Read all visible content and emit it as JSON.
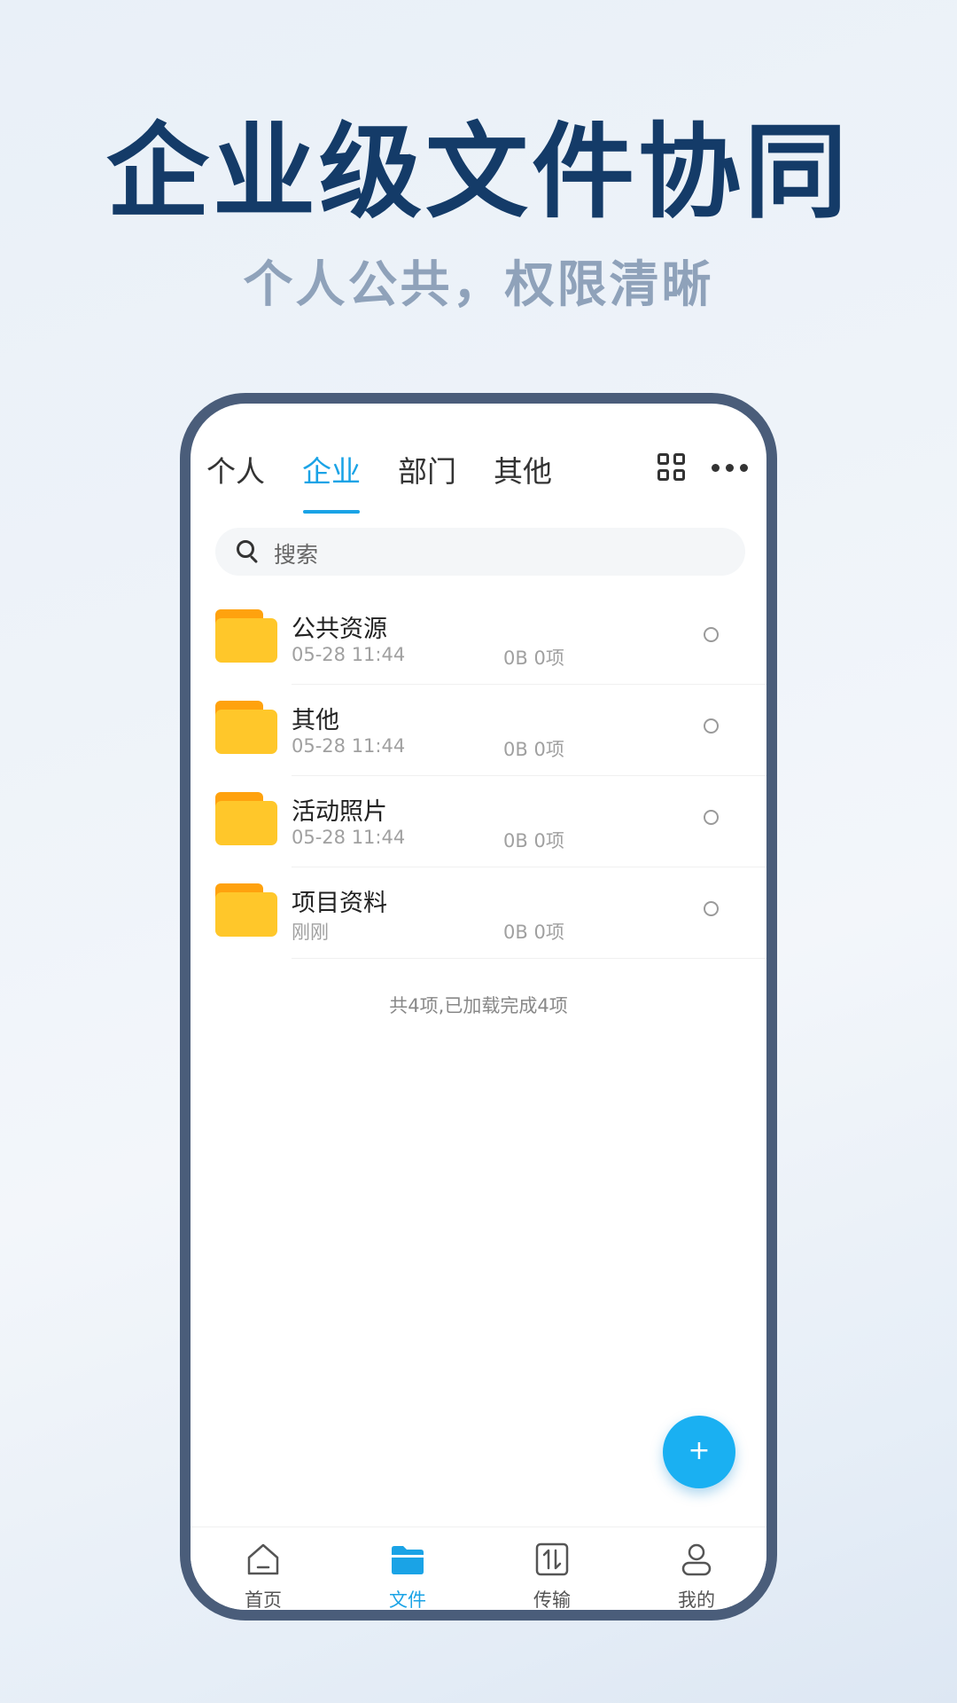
{
  "hero": {
    "title": "企业级文件协同",
    "subtitle": "个人公共，权限清晰"
  },
  "tabs": [
    {
      "label": "个人",
      "active": false
    },
    {
      "label": "企业",
      "active": true
    },
    {
      "label": "部门",
      "active": false
    },
    {
      "label": "其他",
      "active": false
    }
  ],
  "toolbar": {
    "icons": [
      "grid-view-icon",
      "more-icon"
    ]
  },
  "search": {
    "placeholder": "搜索"
  },
  "files": [
    {
      "name": "公共资源",
      "date": "05-28 11:44",
      "size": "0B",
      "count": "0项"
    },
    {
      "name": "其他",
      "date": "05-28 11:44",
      "size": "0B",
      "count": "0项"
    },
    {
      "name": "活动照片",
      "date": "05-28 11:44",
      "size": "0B",
      "count": "0项"
    },
    {
      "name": "项目资料",
      "date": "刚刚",
      "size": "0B",
      "count": "0项"
    }
  ],
  "summary": "共4项,已加载完成4项",
  "fab": {
    "label": "+"
  },
  "bottom_nav": [
    {
      "label": "首页",
      "icon": "home-icon",
      "active": false
    },
    {
      "label": "文件",
      "icon": "folder-icon",
      "active": true
    },
    {
      "label": "传输",
      "icon": "transfer-icon",
      "active": false
    },
    {
      "label": "我的",
      "icon": "profile-icon",
      "active": false
    }
  ],
  "colors": {
    "accent": "#1aa3e6",
    "headline": "#143b68",
    "subheadline": "#8fa2ba",
    "phone_frame": "#4a5d7a",
    "folder": "#ffc72a",
    "folder_tab": "#ffa20e"
  }
}
